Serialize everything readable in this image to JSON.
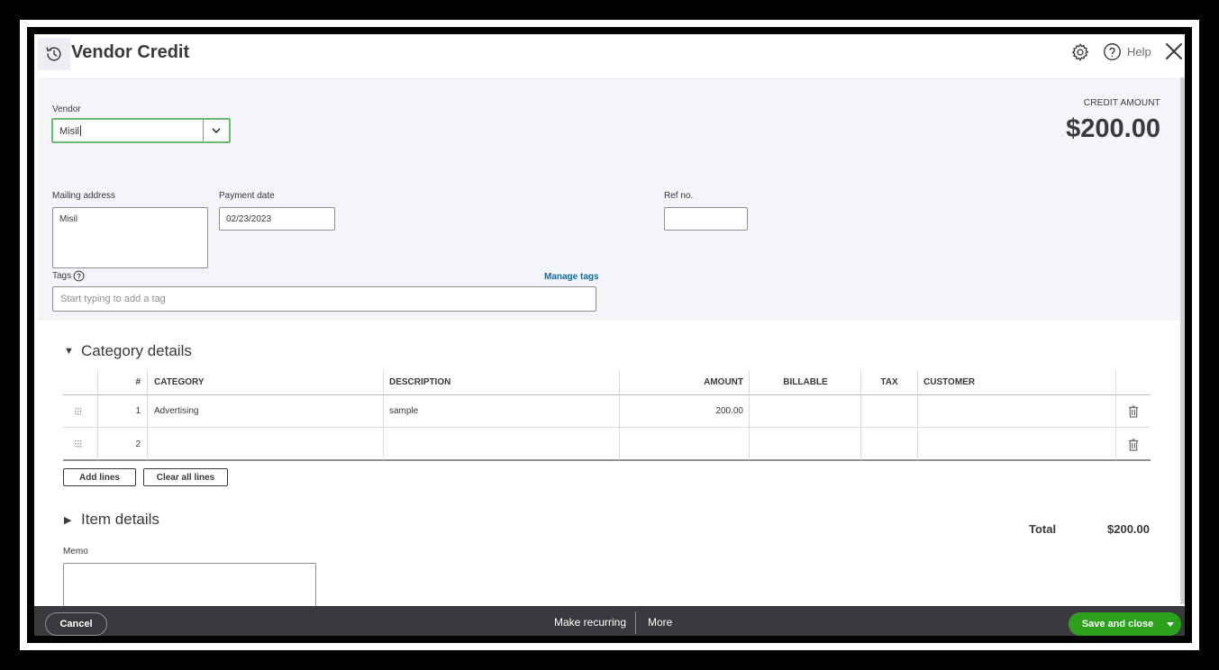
{
  "header": {
    "title": "Vendor Credit",
    "help_label": "Help",
    "icons": {
      "history": "history-icon",
      "settings": "gear-icon",
      "help": "help-icon",
      "close": "close-icon"
    }
  },
  "vendor": {
    "label": "Vendor",
    "value": "Misil"
  },
  "credit": {
    "label": "CREDIT AMOUNT",
    "amount": "$200.00"
  },
  "mailing_address": {
    "label": "Mailing address",
    "value": "Misil"
  },
  "payment_date": {
    "label": "Payment date",
    "value": "02/23/2023"
  },
  "ref_no": {
    "label": "Ref no.",
    "value": ""
  },
  "tags": {
    "label": "Tags",
    "placeholder": "Start typing to add a tag",
    "manage_label": "Manage tags"
  },
  "category_details": {
    "title": "Category details",
    "columns": [
      "#",
      "CATEGORY",
      "DESCRIPTION",
      "AMOUNT",
      "BILLABLE",
      "TAX",
      "CUSTOMER"
    ],
    "rows": [
      {
        "num": "1",
        "category": "Advertising",
        "description": "sample",
        "amount": "200.00",
        "billable": "",
        "tax": "",
        "customer": ""
      },
      {
        "num": "2",
        "category": "",
        "description": "",
        "amount": "",
        "billable": "",
        "tax": "",
        "customer": ""
      }
    ],
    "add_lines_label": "Add lines",
    "clear_lines_label": "Clear all lines"
  },
  "item_details": {
    "title": "Item details"
  },
  "total": {
    "label": "Total",
    "value": "$200.00"
  },
  "memo": {
    "label": "Memo",
    "value": ""
  },
  "footer": {
    "cancel_label": "Cancel",
    "make_recurring_label": "Make recurring",
    "more_label": "More",
    "save_label": "Save and close"
  },
  "colors": {
    "primary_green": "#2ca01c",
    "focus_green": "#6cb96f",
    "link_blue": "#0d6ba6",
    "footer_bg": "#393a3d",
    "form_bg": "#f4f5f8"
  }
}
